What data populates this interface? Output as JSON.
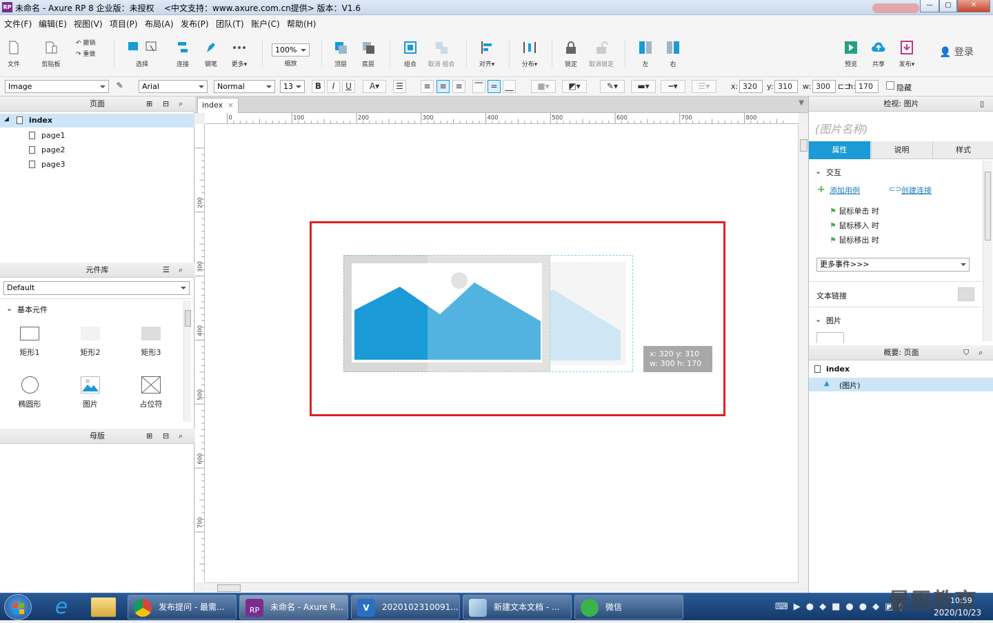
{
  "titlebar": {
    "title": "未命名 - Axure RP 8 企业版：未授权",
    "subtitle": "<中文支持：www.axure.com.cn提供> 版本：V1.6",
    "logo": "RP"
  },
  "menu": [
    "文件(F)",
    "编辑(E)",
    "视图(V)",
    "项目(P)",
    "布局(A)",
    "发布(P)",
    "团队(T)",
    "账户(C)",
    "帮助(H)"
  ],
  "toolbar": {
    "file": "文件",
    "clipboard": "剪贴板",
    "undo": "撤销",
    "redo": "重做",
    "select": "选择",
    "connect": "连接",
    "pen": "钢笔",
    "more": "更多▾",
    "zoom": "100%",
    "zoom_label": "缩放",
    "top": "顶层",
    "bottom": "底层",
    "group": "组合",
    "ungroup": "取消 组合",
    "align": "对齐▾",
    "distribute": "分布▾",
    "lock": "锁定",
    "unlock": "取消锁定",
    "left": "左",
    "right": "右",
    "preview": "预览",
    "share": "共享",
    "publish": "发布▾",
    "login": "登录"
  },
  "format": {
    "style": "Image",
    "font": "Arial",
    "weight": "Normal",
    "size": "13",
    "x_label": "x:",
    "x": "320",
    "y_label": "y:",
    "y": "310",
    "w_label": "w:",
    "w": "300",
    "h_label": "h:",
    "h": "170",
    "hidden": "隐藏"
  },
  "pages": {
    "header": "页面",
    "root": "index",
    "children": [
      "page1",
      "page2",
      "page3"
    ]
  },
  "library": {
    "header": "元件库",
    "selected": "Default",
    "group": "基本元件",
    "widgets": [
      "矩形1",
      "矩形2",
      "矩形3",
      "椭圆形",
      "图片",
      "占位符"
    ]
  },
  "masters": {
    "header": "母版"
  },
  "canvas": {
    "tab": "index",
    "ruler_h": [
      "0",
      "100",
      "200",
      "300",
      "400",
      "500",
      "600",
      "700",
      "800"
    ],
    "ruler_v": [
      "200",
      "300",
      "400",
      "500",
      "600",
      "700"
    ],
    "tooltip_line1": "x: 320    y: 310",
    "tooltip_line2": "w: 300    h: 170"
  },
  "inspector": {
    "header": "检视: 图片",
    "name_placeholder": "(图片名称)",
    "tabs": [
      "属性",
      "说明",
      "样式"
    ],
    "interactions": "交互",
    "add_case": "添加用例",
    "create_link": "创建连接",
    "events": [
      "鼠标单击 时",
      "鼠标移入 时",
      "鼠标移出 时"
    ],
    "more_events": "更多事件>>>",
    "text_link": "文本链接",
    "image_section": "图片"
  },
  "outline": {
    "header": "概要: 页面",
    "root": "index",
    "child": "(图片)"
  },
  "taskbar": {
    "tasks": [
      "发布提问 - 最需...",
      "未命名 - Axure R...",
      "2020102310091...",
      "新建文本文档 - ...",
      "微信"
    ],
    "time": "10:59",
    "date": "2020/10/23",
    "watermark": "最需教育"
  },
  "colors": {
    "accent": "#1a9ad6",
    "selection_red": "#e02020",
    "tab_active": "#1a9ad6"
  }
}
